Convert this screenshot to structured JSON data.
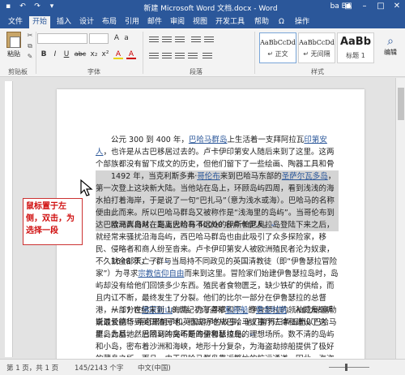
{
  "window": {
    "title": "新建 Microsoft Word 文档.docx - Word",
    "user": "ba BA",
    "quick_access": [
      "save-icon",
      "undo-icon",
      "redo-icon",
      "customize-icon"
    ]
  },
  "tabs": [
    {
      "label": "文件"
    },
    {
      "label": "开始"
    },
    {
      "label": "插入"
    },
    {
      "label": "设计"
    },
    {
      "label": "布局"
    },
    {
      "label": "引用"
    },
    {
      "label": "邮件"
    },
    {
      "label": "审阅"
    },
    {
      "label": "视图"
    },
    {
      "label": "开发工具"
    },
    {
      "label": "帮助"
    },
    {
      "label": "Ω"
    },
    {
      "label": "操作"
    }
  ],
  "ribbon": {
    "paste_label": "粘贴",
    "clipboard_group": "剪贴板",
    "font_group": "字体",
    "paragraph_group": "段落",
    "styles_group": "样式",
    "font_buttons": [
      "B",
      "I",
      "U",
      "abc",
      "x₂",
      "x²",
      "A",
      "A"
    ],
    "styles": [
      {
        "preview": "AaBbCcDd",
        "name": "↵ 正文"
      },
      {
        "preview": "AaBbCcDd",
        "name": "↵ 无间隔"
      },
      {
        "preview": "AaBb",
        "name": "标题 1"
      }
    ],
    "edit_label": "编辑"
  },
  "document": {
    "p1": {
      "a": "公元 300 到 400 年，",
      "link1": "巴哈马群岛",
      "b": "上生活着一支拜阿拉瓦",
      "link2": "印第安人",
      "c": "，也许是从古巴移居过去的。卢卡伊印第安人随后来到了这里。这两个部族都没有留下成文的历史，但他们留下了一些绘画、陶器工具和骨头。"
    },
    "p2": {
      "a": "1492 年，当克利斯多弗·",
      "link1": "哥伦布",
      "b": "来到巴哈马东部的",
      "link2": "圣萨尔瓦多岛",
      "c": "，第一次登上这块新大陆。当他站在岛上，环顾岛屿四周，看到浅浅的海水拍打着海岸，于是说了一句“巴扎马”（意为浅水或海）。巴哈马的名称便由此而来。所以巴哈马群岛又被称作是“浅海里的岛屿”。当哥伦布到达巴哈马群岛时，岛上大约有 40000 名卢卡伊人。"
    },
    "p3": "欧洲人自从在距离巴哈马不远处的伊斯帕尼奥拉岛登陆下来之后，就经常来骚扰沿海岛屿，西巴哈马群岛也由此吸引了众多探险家，移民、侵略者和商人纷至沓来。卢卡伊印第安人被欧洲殖民者沦为奴隶，不久就全部灭亡了。",
    "p4": {
      "a": "1648 年，一群与当局持不同政见的英国清教徒（即“伊鲁瑟拉冒险家”）为寻求",
      "link1": "宗教信仰自由",
      "b": "而来到这里。冒险家们始建伊鲁瑟拉岛时，岛屿却没有给他们回馈多少东西。殖民者食物匮乏，缺少铁矿的供给，而且内讧不断，最终发生了分裂。他们的比尔一部分在伊鲁瑟拉的总督港，一部分在",
      "link2": "佛蒙新山",
      "c": "海湾。为了寻求和平，伊鲁瑟拉的领袖威廉·塞勒斯最长航行到英国殖民地。他成功地从巴哈马议事厅法律和建设了这里，此后，然后回到冲突不断的伊鲁瑟拉岛。"
    },
    "p5": {
      "a": "从 17 世纪末到 18 世纪初海盗和",
      "link1": "私掠船",
      "b": "的",
      "link2": "黄金时期",
      "c": "。人们大都听说过爱德华·蒂奇黑胡子和英国胡子的故事，他们曾将三条五桅以巴哈马群岛为基地。巴哈马的岛屿是海盗和私掠船的理想场所。数不清的岛屿和小岛，密布着沙洲和海峡，地形十分复杂，为海盗劫掠船提供了极好的藏身之所。而且，由于巴哈马群岛靠近繁忙的航运通道，因此，海盗很容易伺机袭击商船提供了大量可乘之机。"
    },
    "pilcrow": "↵"
  },
  "callout": {
    "text": "鼠标置于左侧，双击，为选择一段"
  },
  "status": {
    "page": "第 1 页，共 1 页",
    "words": "145/2143 个字",
    "lang": "中文(中国)"
  }
}
